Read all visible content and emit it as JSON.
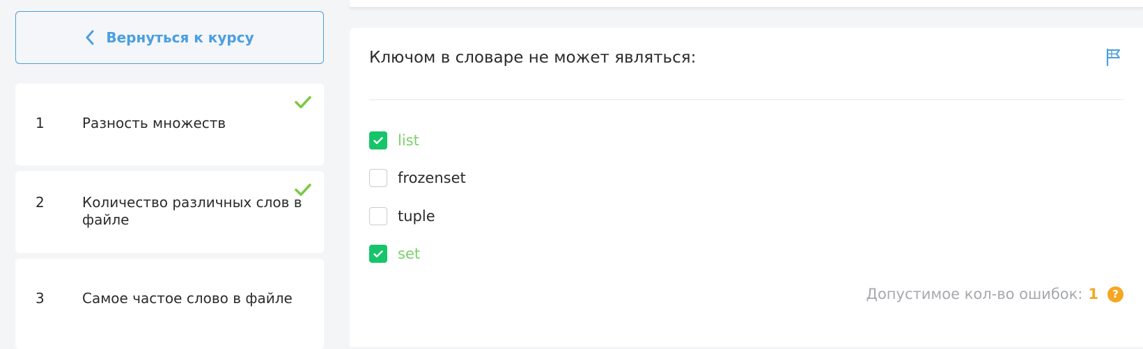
{
  "sidebar": {
    "back_label": "Вернуться к курсу",
    "steps": [
      {
        "number": "1",
        "title": "Разность множеств",
        "completed": true
      },
      {
        "number": "2",
        "title": "Количество различных слов в файле",
        "completed": true
      },
      {
        "number": "3",
        "title": "Самое частое слово в файле",
        "completed": false
      }
    ]
  },
  "quiz": {
    "question": "Ключом в словаре не может являться:",
    "flag_icon": "flag-icon",
    "options": [
      {
        "label": "list",
        "checked": true
      },
      {
        "label": "frozenset",
        "checked": false
      },
      {
        "label": "tuple",
        "checked": false
      },
      {
        "label": "set",
        "checked": true
      }
    ],
    "errors_label": "Допустимое кол-во ошибок:",
    "errors_value": "1",
    "help_symbol": "?"
  },
  "colors": {
    "accent_blue": "#4a9ee0",
    "success_green": "#16c46a",
    "completed_check": "#7bc843",
    "correct_text": "#7bd06a",
    "warning_orange": "#f5a623"
  }
}
